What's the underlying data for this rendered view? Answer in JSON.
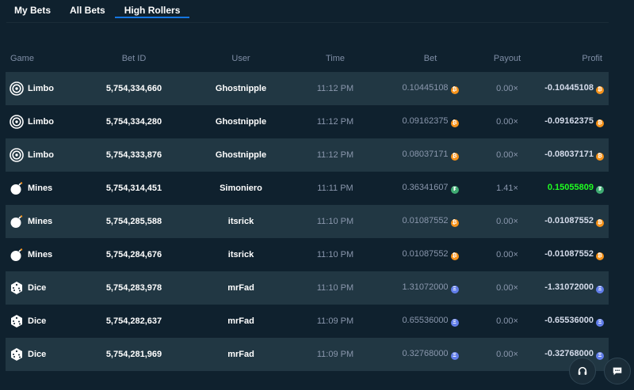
{
  "tabs": [
    {
      "label": "My Bets",
      "active": false
    },
    {
      "label": "All Bets",
      "active": false
    },
    {
      "label": "High Rollers",
      "active": true
    }
  ],
  "columns": {
    "game": "Game",
    "bet_id": "Bet ID",
    "user": "User",
    "time": "Time",
    "bet": "Bet",
    "payout": "Payout",
    "profit": "Profit"
  },
  "rows": [
    {
      "game": "Limbo",
      "icon": "target-icon",
      "bet_id": "5,754,334,660",
      "user": "Ghostnipple",
      "time": "11:12 PM",
      "bet": "0.10445108",
      "coin": "btc",
      "payout": "0.00×",
      "profit": "-0.10445108",
      "win": false
    },
    {
      "game": "Limbo",
      "icon": "target-icon",
      "bet_id": "5,754,334,280",
      "user": "Ghostnipple",
      "time": "11:12 PM",
      "bet": "0.09162375",
      "coin": "btc",
      "payout": "0.00×",
      "profit": "-0.09162375",
      "win": false
    },
    {
      "game": "Limbo",
      "icon": "target-icon",
      "bet_id": "5,754,333,876",
      "user": "Ghostnipple",
      "time": "11:12 PM",
      "bet": "0.08037171",
      "coin": "btc",
      "payout": "0.00×",
      "profit": "-0.08037171",
      "win": false
    },
    {
      "game": "Mines",
      "icon": "bomb-icon",
      "bet_id": "5,754,314,451",
      "user": "Simoniero",
      "time": "11:11 PM",
      "bet": "0.36341607",
      "coin": "usdt",
      "payout": "1.41×",
      "profit": "0.15055809",
      "win": true
    },
    {
      "game": "Mines",
      "icon": "bomb-icon",
      "bet_id": "5,754,285,588",
      "user": "itsrick",
      "time": "11:10 PM",
      "bet": "0.01087552",
      "coin": "btc",
      "payout": "0.00×",
      "profit": "-0.01087552",
      "win": false
    },
    {
      "game": "Mines",
      "icon": "bomb-icon",
      "bet_id": "5,754,284,676",
      "user": "itsrick",
      "time": "11:10 PM",
      "bet": "0.01087552",
      "coin": "btc",
      "payout": "0.00×",
      "profit": "-0.01087552",
      "win": false
    },
    {
      "game": "Dice",
      "icon": "dice-icon",
      "bet_id": "5,754,283,978",
      "user": "mrFad",
      "time": "11:10 PM",
      "bet": "1.31072000",
      "coin": "eth",
      "payout": "0.00×",
      "profit": "-1.31072000",
      "win": false
    },
    {
      "game": "Dice",
      "icon": "dice-icon",
      "bet_id": "5,754,282,637",
      "user": "mrFad",
      "time": "11:09 PM",
      "bet": "0.65536000",
      "coin": "eth",
      "payout": "0.00×",
      "profit": "-0.65536000",
      "win": false
    },
    {
      "game": "Dice",
      "icon": "dice-icon",
      "bet_id": "5,754,281,969",
      "user": "mrFad",
      "time": "11:09 PM",
      "bet": "0.32768000",
      "coin": "eth",
      "payout": "0.00×",
      "profit": "-0.32768000",
      "win": false
    }
  ],
  "widgets": {
    "support_icon": "headset-icon",
    "chat_icon": "chat-icon"
  },
  "colors": {
    "accent": "#1475e1",
    "win": "#1fff20",
    "btc": "#f7931a",
    "eth": "#627eea",
    "usdt": "#3fab72"
  }
}
